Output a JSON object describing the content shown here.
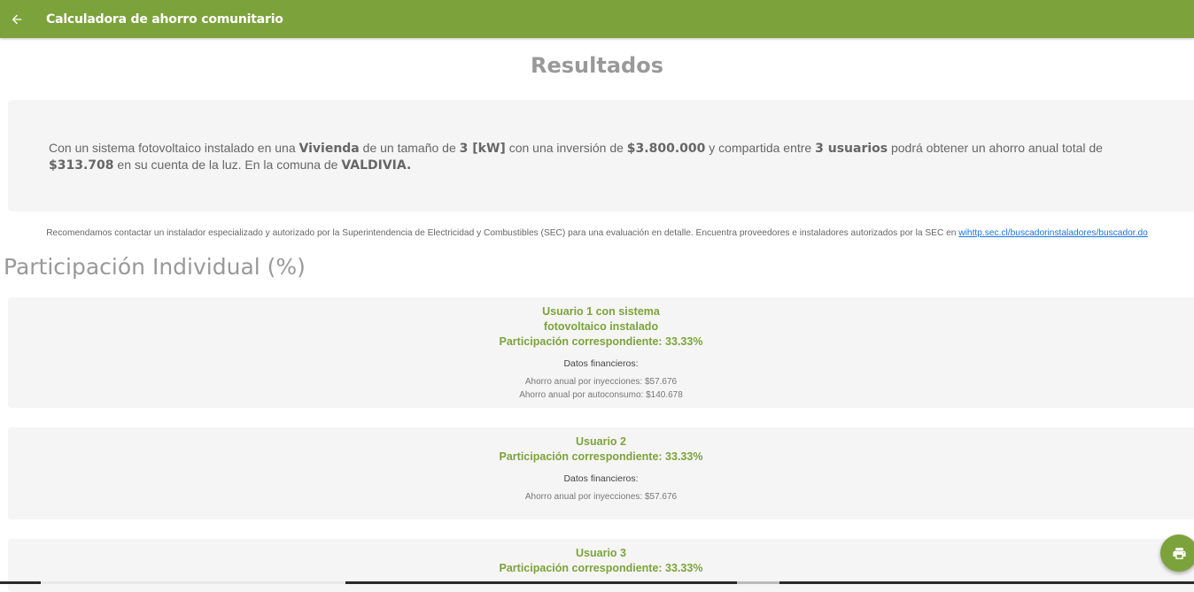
{
  "appbar": {
    "title": "Calculadora de ahorro comunitario",
    "back_icon": "arrow-left-icon"
  },
  "results": {
    "heading": "Resultados",
    "summary": {
      "p1": "Con un sistema fotovoltaico instalado en una ",
      "housing": "Vivienda",
      "p2": " de un tamaño de ",
      "size": "3 [kW]",
      "p3": " con una inversión de ",
      "investment": "$3.800.000",
      "p4": " y compartida entre ",
      "users": "3 usuarios",
      "p5": " podrá obtener un ahorro anual total de ",
      "savings": "$313.708",
      "p6": " en su cuenta de la luz. En la comuna de ",
      "commune": "VALDIVIA."
    },
    "recommendation": "Recomendamos contactar un instalador especializado y autorizado por la Superintendencia de Electricidad y Combustibles (SEC) para una evaluación en detalle. Encuentra proveedores e instaladores autorizados por la SEC en ",
    "recommendation_link": "wihttp.sec.cl/buscadorinstaladores/buscador.do"
  },
  "participation": {
    "heading": "Participación Individual (%)",
    "users": [
      {
        "title_line1": "Usuario 1 con sistema",
        "title_line2": "fotovoltaico instalado",
        "share": "Participación correspondiente: 33.33%",
        "fin_label": "Datos financieros:",
        "fin_items": [
          "Ahorro anual por inyecciones: $57.676",
          "Ahorro anual por autoconsumo: $140.678"
        ]
      },
      {
        "title_line1": "Usuario 2",
        "share": "Participación correspondiente: 33.33%",
        "fin_label": "Datos financieros:",
        "fin_items": [
          "Ahorro anual por inyecciones: $57.676"
        ]
      },
      {
        "title_line1": "Usuario 3",
        "share": "Participación correspondiente: 33.33%"
      }
    ]
  },
  "fab": {
    "icon": "printer-icon"
  },
  "colors": {
    "primary": "#7ca33b",
    "card_bg": "#f5f5f5",
    "heading": "#999999"
  }
}
